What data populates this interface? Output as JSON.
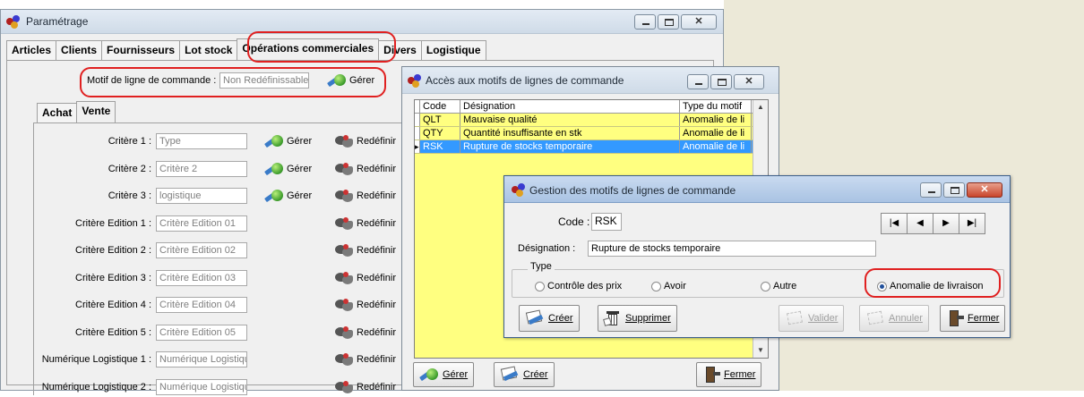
{
  "window_main": {
    "title": "Paramétrage",
    "tabs": [
      {
        "label": "Articles",
        "active": false
      },
      {
        "label": "Clients",
        "active": false
      },
      {
        "label": "Fournisseurs",
        "active": false
      },
      {
        "label": "Lot stock",
        "active": false
      },
      {
        "label": "Opérations commerciales",
        "active": true
      },
      {
        "label": "Divers",
        "active": false
      },
      {
        "label": "Logistique",
        "active": false
      }
    ],
    "motif": {
      "label": "Motif de ligne de commande :",
      "value": "Non Redéfinissable",
      "button": "Gérer"
    },
    "subtabs": [
      {
        "label": "Achat",
        "active": false
      },
      {
        "label": "Vente",
        "active": true
      }
    ],
    "fields": [
      {
        "label": "Critère 1 :",
        "value": "Type",
        "gerer": "Gérer",
        "redefinir": "Redéfinir"
      },
      {
        "label": "Critère 2 :",
        "value": "Critère 2",
        "gerer": "Gérer",
        "redefinir": "Redéfinir"
      },
      {
        "label": "Critère 3 :",
        "value": "logistique",
        "gerer": "Gérer",
        "redefinir": "Redéfinir"
      },
      {
        "label": "Critère Edition 1 :",
        "value": "Critère Edition 01",
        "gerer": "",
        "redefinir": "Redéfinir"
      },
      {
        "label": "Critère Edition 2 :",
        "value": "Critère Edition 02",
        "gerer": "",
        "redefinir": "Redéfinir"
      },
      {
        "label": "Critère Edition 3 :",
        "value": "Critère Edition 03",
        "gerer": "",
        "redefinir": "Redéfinir"
      },
      {
        "label": "Critère Edition 4 :",
        "value": "Critère Edition 04",
        "gerer": "",
        "redefinir": "Redéfinir"
      },
      {
        "label": "Critère Edition 5 :",
        "value": "Critère Edition 05",
        "gerer": "",
        "redefinir": "Redéfinir"
      },
      {
        "label": "Numérique Logistique 1 :",
        "value": "Numérique Logistiqu",
        "gerer": "",
        "redefinir": "Redéfinir"
      },
      {
        "label": "Numérique Logistique 2 :",
        "value": "Numérique Logistiqu",
        "gerer": "",
        "redefinir": "Redéfinir"
      }
    ]
  },
  "window_acces": {
    "title": "Accès aux motifs de lignes de commande",
    "columns": [
      "Code",
      "Désignation",
      "Type du motif"
    ],
    "rows": [
      {
        "code": "QLT",
        "designation": "Mauvaise qualité",
        "type": "Anomalie de li",
        "selected": false
      },
      {
        "code": "QTY",
        "designation": "Quantité insuffisante en stk",
        "type": "Anomalie de li",
        "selected": false
      },
      {
        "code": "RSK",
        "designation": "Rupture de stocks temporaire",
        "type": "Anomalie de li",
        "selected": true
      }
    ],
    "buttons": {
      "gerer": "Gérer",
      "creer": "Créer",
      "fermer": "Fermer"
    }
  },
  "window_gestion": {
    "title": "Gestion des motifs de lignes de commande",
    "code_label": "Code :",
    "code_value": "RSK",
    "designation_label": "Désignation :",
    "designation_value": "Rupture de stocks temporaire",
    "type_legend": "Type",
    "radios": [
      {
        "label": "Contrôle des prix",
        "checked": false
      },
      {
        "label": "Avoir",
        "checked": false
      },
      {
        "label": "Autre",
        "checked": false
      },
      {
        "label": "Anomalie de livraison",
        "checked": true
      }
    ],
    "buttons": {
      "creer": "Créer",
      "supprimer": "Supprimer",
      "valider": "Valider",
      "annuler": "Annuler",
      "fermer": "Fermer"
    },
    "nav_glyphs": {
      "first": "|◀",
      "prev": "◀",
      "next": "▶",
      "last": "▶|"
    }
  },
  "colors": {
    "grid_bg": "#ffff80",
    "selection": "#3399ff",
    "highlight": "#e02020"
  }
}
